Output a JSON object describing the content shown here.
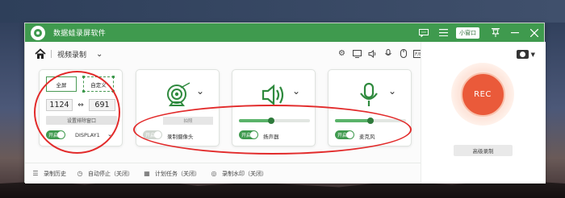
{
  "window": {
    "title": "数据蛙录屏软件",
    "mini_window_label": "小窗口"
  },
  "toolbar": {
    "mode_label": "视频录制"
  },
  "screen_card": {
    "fullscreen_label": "全屏",
    "custom_label": "自定义",
    "width": "1124",
    "height": "691",
    "set_window_label": "设置排除窗口",
    "toggle_label": "开启",
    "display_label": "DISPLAY1"
  },
  "camera_card": {
    "sub_label": "拍照",
    "toggle_label": "开启",
    "name": "录制摄像头"
  },
  "speaker_card": {
    "toggle_label": "开启",
    "name": "扬声器",
    "volume": 0.45
  },
  "mic_card": {
    "toggle_label": "开启",
    "name": "麦克风",
    "volume": 0.5
  },
  "record": {
    "rec_label": "REC",
    "advanced_label": "高级录制"
  },
  "footer": {
    "items": [
      {
        "label": "录制历史",
        "icon": "list-icon"
      },
      {
        "label": "自动停止（关闭）",
        "icon": "clock-stop-icon"
      },
      {
        "label": "计划任务（关闭）",
        "icon": "calendar-icon"
      },
      {
        "label": "录制水印（关闭）",
        "icon": "watermark-icon"
      }
    ]
  },
  "top_icons": {
    "fn_label": "F/B"
  },
  "colors": {
    "brand_green": "#3f9a4e",
    "rec_red": "#ea5a3a",
    "annotation_red": "#e22b2b"
  }
}
